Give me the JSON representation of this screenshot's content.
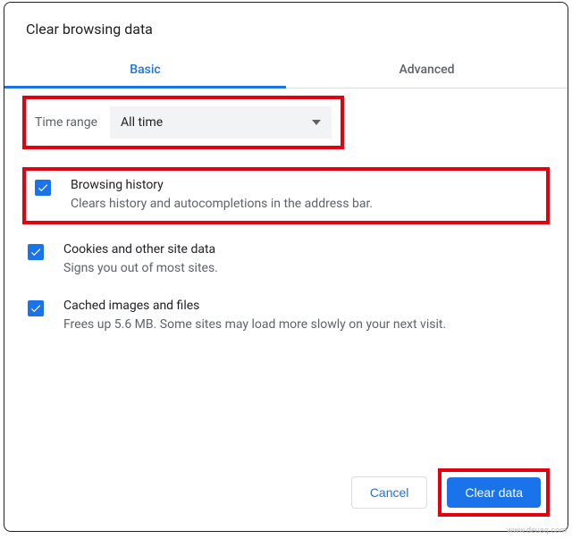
{
  "title": "Clear browsing data",
  "tabs": {
    "basic": "Basic",
    "advanced": "Advanced"
  },
  "time": {
    "label": "Time range",
    "value": "All time"
  },
  "options": [
    {
      "title": "Browsing history",
      "desc": "Clears history and autocompletions in the address bar."
    },
    {
      "title": "Cookies and other site data",
      "desc": "Signs you out of most sites."
    },
    {
      "title": "Cached images and files",
      "desc": "Frees up 5.6 MB. Some sites may load more slowly on your next visit."
    }
  ],
  "buttons": {
    "cancel": "Cancel",
    "clear": "Clear data"
  },
  "watermark": "www.deuaq.com"
}
